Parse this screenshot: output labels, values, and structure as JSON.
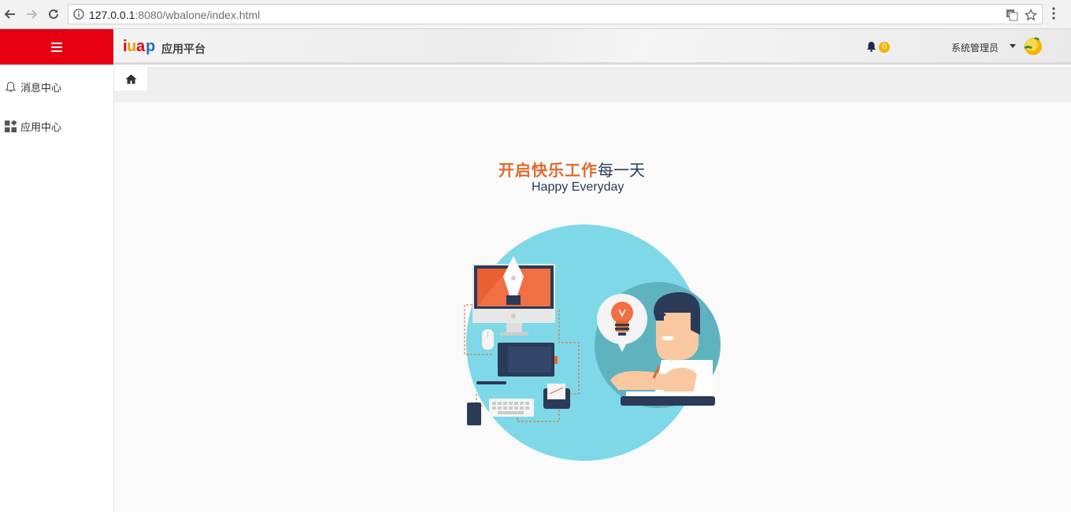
{
  "browser": {
    "url_host": "127.0.0.1",
    "url_rest": ":8080/wbalone/index.html"
  },
  "header": {
    "logo_text": "iuap",
    "logo_subtitle": "应用平台",
    "notification_count": "0",
    "user_name": "系统管理员"
  },
  "sidebar": {
    "items": [
      {
        "label": "消息中心",
        "icon": "bell-outline-icon"
      },
      {
        "label": "应用中心",
        "icon": "apps-grid-icon"
      }
    ]
  },
  "tabs": {
    "home_icon": "home-icon"
  },
  "main": {
    "slogan_highlight": "开启快乐工作",
    "slogan_rest": "每一天",
    "subslogan": "Happy Everyday"
  },
  "colors": {
    "brand_red": "#e60012",
    "slogan_orange": "#e06a2c",
    "slogan_navy": "#2b3a57",
    "badge_yellow": "#f5b400",
    "illustration_circle": "#7fd8e8"
  }
}
